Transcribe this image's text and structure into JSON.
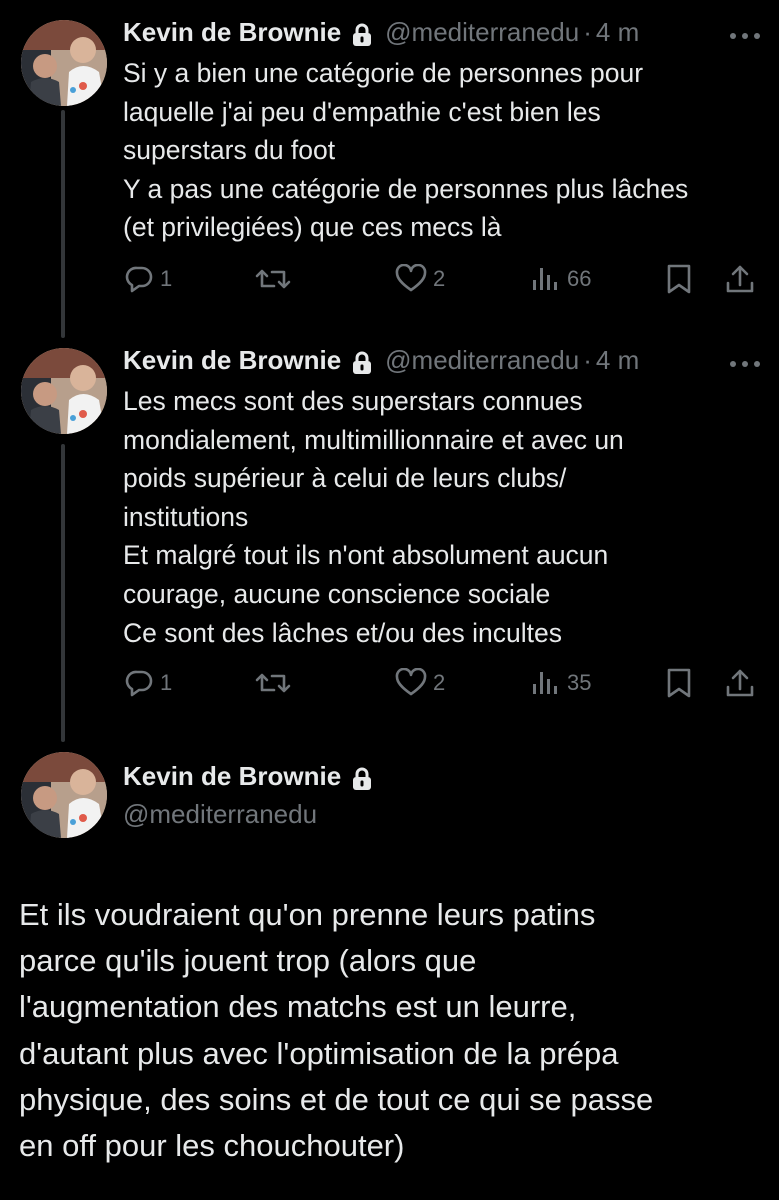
{
  "colors": {
    "background": "#000000",
    "text_primary": "#e7e9ea",
    "text_secondary": "#71767b",
    "thread_line": "#333639"
  },
  "icons": {
    "lock": "lock-icon",
    "more": "more-icon",
    "reply": "reply-icon",
    "retweet": "retweet-icon",
    "like": "like-icon",
    "views": "views-icon",
    "bookmark": "bookmark-icon",
    "share": "share-icon"
  },
  "tweets": [
    {
      "author_name": "Kevin de Brownie",
      "handle": "@mediterranedu",
      "separator": "·",
      "time": "4 m",
      "lines": [
        "Si y a bien une catégorie de personnes pour",
        "laquelle j'ai peu d'empathie c'est bien les",
        "superstars du foot",
        "Y a pas une catégorie de personnes plus lâches",
        "(et privilegiées) que ces mecs là"
      ],
      "replies": "1",
      "likes": "2",
      "views": "66"
    },
    {
      "author_name": "Kevin de Brownie",
      "handle": "@mediterranedu",
      "separator": "·",
      "time": "4 m",
      "lines": [
        "Les mecs sont des superstars connues",
        "mondialement, multimillionnaire et avec un",
        "poids supérieur à celui de leurs clubs/",
        "institutions",
        "Et malgré tout ils n'ont absolument aucun",
        "courage, aucune conscience sociale",
        "Ce sont des lâches et/ou des incultes"
      ],
      "replies": "1",
      "likes": "2",
      "views": "35"
    }
  ],
  "main_tweet": {
    "author_name": "Kevin de Brownie",
    "handle": "@mediterranedu",
    "lines": [
      "Et ils voudraient qu'on prenne leurs patins",
      "parce qu'ils jouent trop (alors que",
      "l'augmentation des matchs est un leurre,",
      "d'autant plus avec l'optimisation de la prépa",
      "physique, des soins et de tout ce qui se passe",
      "en off pour les chouchouter)"
    ]
  }
}
